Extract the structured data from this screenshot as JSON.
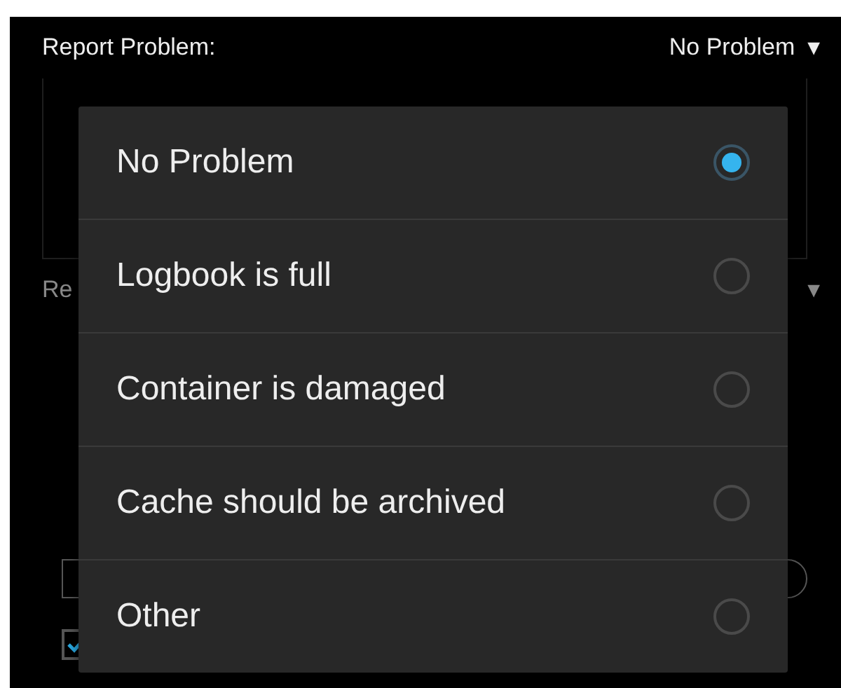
{
  "report_problem": {
    "label": "Report Problem:",
    "value": "No Problem",
    "caret": "▼"
  },
  "second_row": {
    "label": "Re",
    "caret": "▼"
  },
  "twitter_checkbox": {
    "checked": true
  },
  "dialog": {
    "options": [
      {
        "label": "No Problem",
        "selected": true
      },
      {
        "label": "Logbook is full",
        "selected": false
      },
      {
        "label": "Container is damaged",
        "selected": false
      },
      {
        "label": "Cache should be archived",
        "selected": false
      },
      {
        "label": "Other",
        "selected": false
      }
    ]
  }
}
